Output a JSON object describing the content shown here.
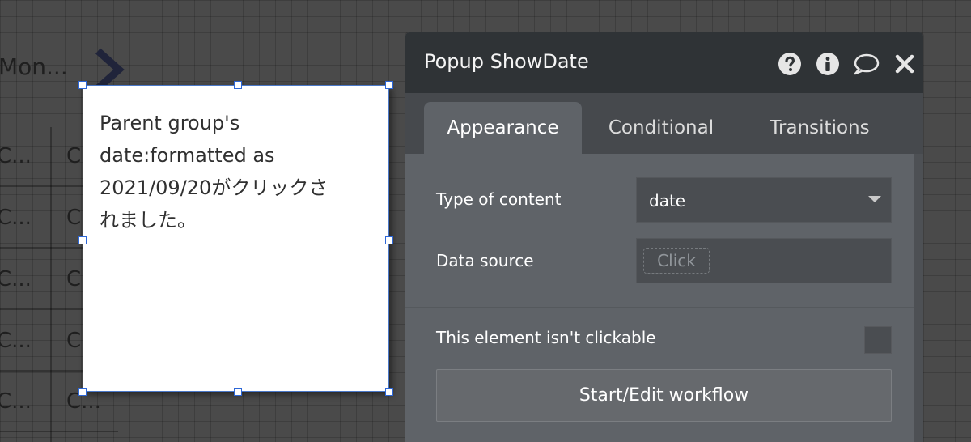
{
  "canvas": {
    "month_label": "Mon...",
    "left_cells": [
      "C...",
      "C...",
      "C...",
      "C...",
      "C..."
    ],
    "right_cells": [
      "C",
      "C",
      "C",
      "C",
      "C..."
    ]
  },
  "popup_element": {
    "text": "Parent group's\ndate:formatted as\n2021/09/20がクリックさ\nれました。"
  },
  "property_editor": {
    "title": "Popup ShowDate",
    "icons": {
      "help": "question-circle-icon",
      "info": "info-circle-icon",
      "comment": "comment-bubble-icon",
      "close": "close-icon"
    },
    "tabs": [
      {
        "label": "Appearance"
      },
      {
        "label": "Conditional"
      },
      {
        "label": "Transitions"
      }
    ],
    "fields": {
      "type_of_content_label": "Type of content",
      "type_of_content_value": "date",
      "data_source_label": "Data source",
      "data_source_value": "Click",
      "clickable_label": "This element isn't clickable",
      "workflow_button_label": "Start/Edit workflow"
    }
  },
  "colors": {
    "canvas": "#4a4a4a",
    "panel": "#5f6368",
    "header": "#2f3336",
    "selection": "#2d67d7"
  }
}
